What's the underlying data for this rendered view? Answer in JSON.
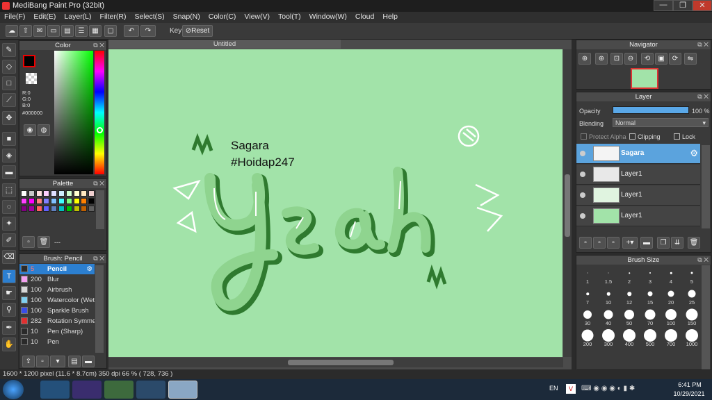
{
  "window": {
    "title": "MediBang Paint Pro (32bit)",
    "minimize": "—",
    "maximize": "❐",
    "close": "✕"
  },
  "menu": [
    "File(F)",
    "Edit(E)",
    "Layer(L)",
    "Filter(R)",
    "Select(S)",
    "Snap(N)",
    "Color(C)",
    "View(V)",
    "Tool(T)",
    "Window(W)",
    "Cloud",
    "Help"
  ],
  "toolbar": {
    "key_label": "Key",
    "reset_label": "Reset"
  },
  "color_panel": {
    "title": "Color",
    "r": "R:0",
    "g": "G:0",
    "b": "B:0",
    "hex": "#000000"
  },
  "palette_panel": {
    "title": "Palette",
    "dash": "---"
  },
  "brush_panel": {
    "title": "Brush: Pencil",
    "items": [
      {
        "size": "5",
        "name": "Pencil",
        "color": "#2a2a2a"
      },
      {
        "size": "200",
        "name": "Blur",
        "color": "#f4a0f0"
      },
      {
        "size": "100",
        "name": "Airbrush",
        "color": "#d8d8d8"
      },
      {
        "size": "100",
        "name": "Watercolor (Wet)",
        "color": "#7fd0f0"
      },
      {
        "size": "100",
        "name": "Sparkle Brush",
        "color": "#3a4de8"
      },
      {
        "size": "282",
        "name": "Rotation Symmetry",
        "color": "#e03030"
      },
      {
        "size": "10",
        "name": "Pen (Sharp)",
        "color": "#2a2a2a"
      },
      {
        "size": "10",
        "name": "Pen",
        "color": "#2a2a2a"
      }
    ]
  },
  "document": {
    "tab": "Untitled",
    "text_line1": "Sagara",
    "text_line2": "#Hoidap247",
    "lettering": "Yeah"
  },
  "navigator": {
    "title": "Navigator"
  },
  "layer_panel": {
    "title": "Layer",
    "opacity_label": "Opacity",
    "opacity_value": "100 %",
    "opacity_fraction": 1.0,
    "blending_label": "Blending",
    "blending_value": "Normal",
    "protect_alpha": "Protect Alpha",
    "clipping": "Clipping",
    "lock": "Lock",
    "layers": [
      {
        "name": "Sagara",
        "selected": true
      },
      {
        "name": "Layer1",
        "selected": false
      },
      {
        "name": "Layer1",
        "selected": false
      },
      {
        "name": "Layer1",
        "selected": false
      }
    ]
  },
  "brush_size_panel": {
    "title": "Brush Size",
    "sizes": [
      "1",
      "1.5",
      "2",
      "3",
      "4",
      "5",
      "7",
      "10",
      "12",
      "15",
      "20",
      "25",
      "30",
      "40",
      "50",
      "70",
      "100",
      "150",
      "200",
      "300",
      "400",
      "500",
      "700",
      "1000"
    ]
  },
  "status": {
    "text": "1600 * 1200 pixel   (11.6 * 8.7cm)   350 dpi   66 %   ( 728, 736 )"
  },
  "taskbar": {
    "lang": "EN",
    "time": "6:41 PM",
    "date": "10/29/2021"
  }
}
